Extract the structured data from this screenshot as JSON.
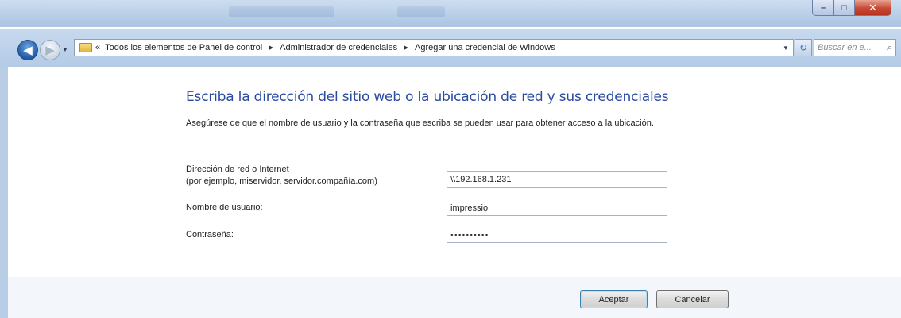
{
  "window": {
    "controls": {
      "minimize": "–",
      "maximize": "□",
      "close": "✕"
    }
  },
  "nav": {
    "back_icon": "arrow-left-icon",
    "forward_icon": "arrow-right-icon",
    "overflow": "«",
    "breadcrumbs": [
      "Todos los elementos de Panel de control",
      "Administrador de credenciales",
      "Agregar una credencial de Windows"
    ],
    "separator": "►",
    "refresh_glyph": "↻",
    "search_placeholder": "Buscar en e...",
    "search_icon": "⌕"
  },
  "main": {
    "heading": "Escriba la dirección del sitio web o la ubicación de red y sus credenciales",
    "description": "Asegúrese de que el nombre de usuario y la contraseña que escriba se pueden usar para obtener acceso a la ubicación.",
    "address_label": "Dirección de red o Internet",
    "address_hint": "(por ejemplo, miservidor, servidor.compañía.com)",
    "address_value": "\\\\192.168.1.231",
    "username_label": "Nombre de usuario:",
    "username_value": "impressio",
    "password_label": "Contraseña:",
    "password_value": "••••••••••"
  },
  "footer": {
    "ok_label": "Aceptar",
    "cancel_label": "Cancelar"
  },
  "colors": {
    "heading": "#2a4aa0",
    "chrome": "#b4cbe6",
    "close": "#c74a35"
  }
}
